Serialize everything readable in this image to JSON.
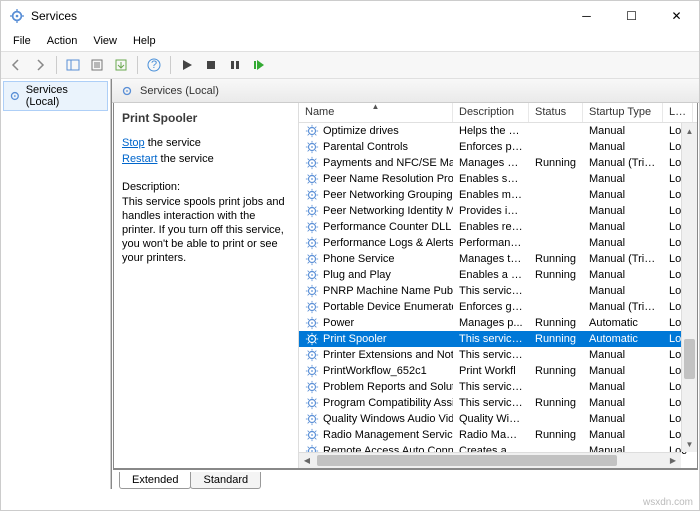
{
  "app": {
    "title": "Services"
  },
  "menu": {
    "file": "File",
    "action": "Action",
    "view": "View",
    "help": "Help"
  },
  "tree": {
    "root": "Services (Local)"
  },
  "pane": {
    "header": "Services (Local)"
  },
  "detail": {
    "title": "Print Spooler",
    "stop_link": "Stop",
    "stop_suffix": " the service",
    "restart_link": "Restart",
    "restart_suffix": " the service",
    "desc_label": "Description:",
    "desc_text": "This service spools print jobs and handles interaction with the printer. If you turn off this service, you won't be able to print or see your printers."
  },
  "columns": {
    "name": "Name",
    "description": "Description",
    "status": "Status",
    "startup": "Startup Type",
    "logon": "Log"
  },
  "services": [
    {
      "name": "Optimize drives",
      "desc": "Helps the c...",
      "status": "",
      "startup": "Manual",
      "logon": "Loc"
    },
    {
      "name": "Parental Controls",
      "desc": "Enforces pa...",
      "status": "",
      "startup": "Manual",
      "logon": "Loc"
    },
    {
      "name": "Payments and NFC/SE Man...",
      "desc": "Manages pa...",
      "status": "Running",
      "startup": "Manual (Trig...",
      "logon": "Loc"
    },
    {
      "name": "Peer Name Resolution Prot...",
      "desc": "Enables serv...",
      "status": "",
      "startup": "Manual",
      "logon": "Loc"
    },
    {
      "name": "Peer Networking Grouping",
      "desc": "Enables mul...",
      "status": "",
      "startup": "Manual",
      "logon": "Loc"
    },
    {
      "name": "Peer Networking Identity M...",
      "desc": "Provides ide...",
      "status": "",
      "startup": "Manual",
      "logon": "Loc"
    },
    {
      "name": "Performance Counter DLL ...",
      "desc": "Enables rem...",
      "status": "",
      "startup": "Manual",
      "logon": "Loc"
    },
    {
      "name": "Performance Logs & Alerts",
      "desc": "Performanc...",
      "status": "",
      "startup": "Manual",
      "logon": "Loc"
    },
    {
      "name": "Phone Service",
      "desc": "Manages th...",
      "status": "Running",
      "startup": "Manual (Trig...",
      "logon": "Loc"
    },
    {
      "name": "Plug and Play",
      "desc": "Enables a c...",
      "status": "Running",
      "startup": "Manual",
      "logon": "Loc"
    },
    {
      "name": "PNRP Machine Name Publi...",
      "desc": "This service ...",
      "status": "",
      "startup": "Manual",
      "logon": "Loc"
    },
    {
      "name": "Portable Device Enumerator...",
      "desc": "Enforces gr...",
      "status": "",
      "startup": "Manual (Trig...",
      "logon": "Loc"
    },
    {
      "name": "Power",
      "desc": "Manages p...",
      "status": "Running",
      "startup": "Automatic",
      "logon": "Loc"
    },
    {
      "name": "Print Spooler",
      "desc": "This service ...",
      "status": "Running",
      "startup": "Automatic",
      "logon": "Loc",
      "selected": true
    },
    {
      "name": "Printer Extensions and Notif...",
      "desc": "This service ...",
      "status": "",
      "startup": "Manual",
      "logon": "Loc"
    },
    {
      "name": "PrintWorkflow_652c1",
      "desc": "Print Workfl",
      "status": "Running",
      "startup": "Manual",
      "logon": "Loc"
    },
    {
      "name": "Problem Reports and Soluti...",
      "desc": "This service ...",
      "status": "",
      "startup": "Manual",
      "logon": "Loc"
    },
    {
      "name": "Program Compatibility Assi...",
      "desc": "This service ...",
      "status": "Running",
      "startup": "Manual",
      "logon": "Loc"
    },
    {
      "name": "Quality Windows Audio Vid...",
      "desc": "Quality Win...",
      "status": "",
      "startup": "Manual",
      "logon": "Loc"
    },
    {
      "name": "Radio Management Service",
      "desc": "Radio Mana...",
      "status": "Running",
      "startup": "Manual",
      "logon": "Loc"
    },
    {
      "name": "Remote Access Auto Conne...",
      "desc": "Creates a co...",
      "status": "",
      "startup": "Manual",
      "logon": "Loc"
    }
  ],
  "tabs": {
    "extended": "Extended",
    "standard": "Standard"
  },
  "watermark": "wsxdn.com"
}
